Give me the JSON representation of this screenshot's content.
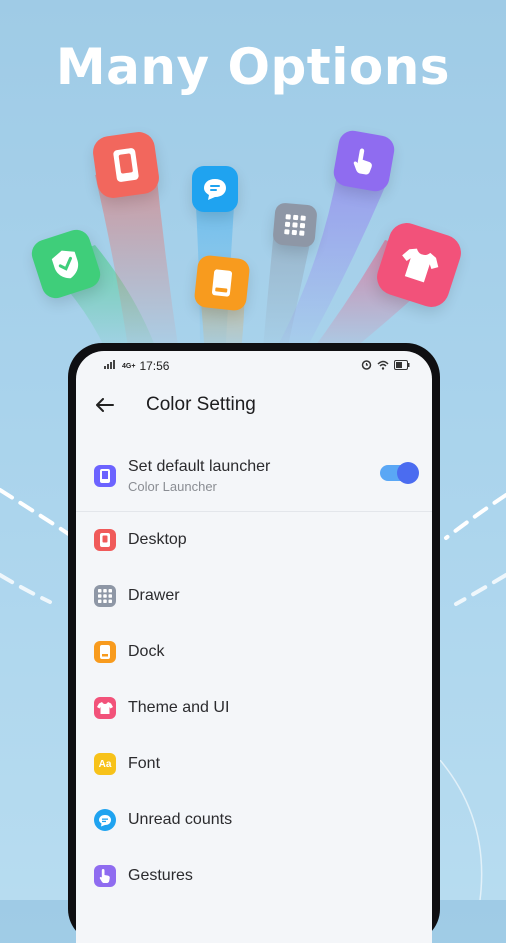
{
  "headline": "Many Options",
  "status_bar": {
    "time": "17:56",
    "network": "4G+",
    "battery_icon": "battery-icon"
  },
  "header": {
    "title": "Color Setting",
    "back_icon": "back-arrow-icon"
  },
  "settings": [
    {
      "label": "Set default launcher",
      "sublabel": "Color Launcher",
      "icon": "phone-icon",
      "color": "#6c63ff",
      "toggle_on": true
    },
    {
      "label": "Desktop",
      "icon": "desktop-icon",
      "color": "#f05a5a"
    },
    {
      "label": "Drawer",
      "icon": "grid-icon",
      "color": "#8e97a6"
    },
    {
      "label": "Dock",
      "icon": "dock-icon",
      "color": "#f89b1e"
    },
    {
      "label": "Theme and UI",
      "icon": "shirt-icon",
      "color": "#f2527a"
    },
    {
      "label": "Font",
      "icon": "font-icon",
      "color": "#f7c21a",
      "glyph": "Aa"
    },
    {
      "label": "Unread counts",
      "icon": "chat-icon",
      "color": "#1fa3f0"
    },
    {
      "label": "Gestures",
      "icon": "hand-icon",
      "color": "#8f6cf0"
    }
  ],
  "colors": {
    "accent": "#4b6cf0",
    "toggle_track": "#5aa7f5"
  }
}
